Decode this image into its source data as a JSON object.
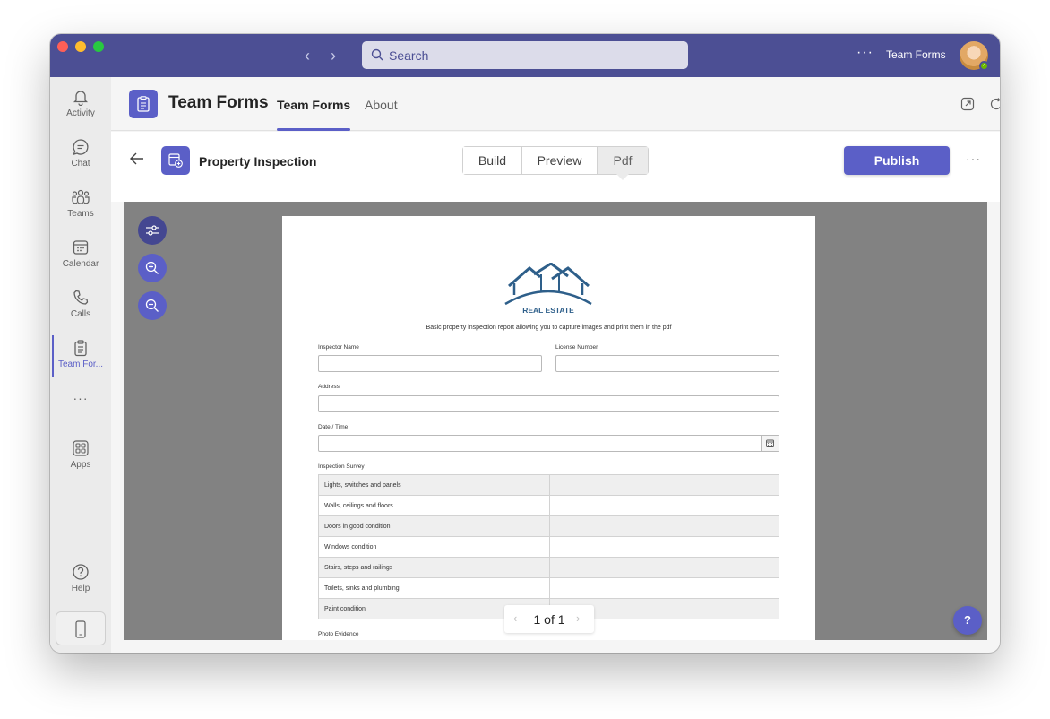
{
  "titlebar": {
    "search_placeholder": "Search",
    "more": "···",
    "app_name": "Team Forms"
  },
  "rail": {
    "items": [
      {
        "label": "Activity",
        "icon": "bell-icon"
      },
      {
        "label": "Chat",
        "icon": "chat-icon"
      },
      {
        "label": "Teams",
        "icon": "teams-icon"
      },
      {
        "label": "Calendar",
        "icon": "calendar-icon"
      },
      {
        "label": "Calls",
        "icon": "phone-icon"
      },
      {
        "label": "Team For...",
        "icon": "clipboard-icon"
      },
      {
        "label": "Apps",
        "icon": "apps-icon"
      },
      {
        "label": "Help",
        "icon": "help-icon"
      }
    ],
    "more": "···"
  },
  "app_header": {
    "title": "Team Forms",
    "tabs": [
      {
        "label": "Team Forms",
        "active": true
      },
      {
        "label": "About",
        "active": false
      }
    ]
  },
  "toolbar": {
    "form_title": "Property Inspection",
    "views": [
      "Build",
      "Preview",
      "Pdf"
    ],
    "active_view": "Pdf",
    "publish_label": "Publish",
    "more": "···"
  },
  "pdf": {
    "logo_text": "REAL ESTATE",
    "description": "Basic property inspection report allowing you to capture images and print them in the pdf",
    "fields": {
      "inspector_name": "Inspector Name",
      "license_number": "License Number",
      "address": "Address",
      "date_time": "Date / Time",
      "inspection_survey": "Inspection Survey",
      "photo_evidence": "Photo Evidence"
    },
    "survey_rows": [
      "Lights, switches and panels",
      "Walls, ceilings and floors",
      "Doors in good condition",
      "Windows condition",
      "Stairs, steps and railings",
      "Toilets, sinks and plumbing",
      "Paint condition"
    ],
    "pager": {
      "text": "1 of 1",
      "prev": "‹",
      "next": "›"
    }
  },
  "help_fab": "?",
  "colors": {
    "titlebar": "#4c4f94",
    "accent": "#5b5fc7",
    "viewer_bg": "#828282",
    "logo": "#2e5f8a"
  }
}
